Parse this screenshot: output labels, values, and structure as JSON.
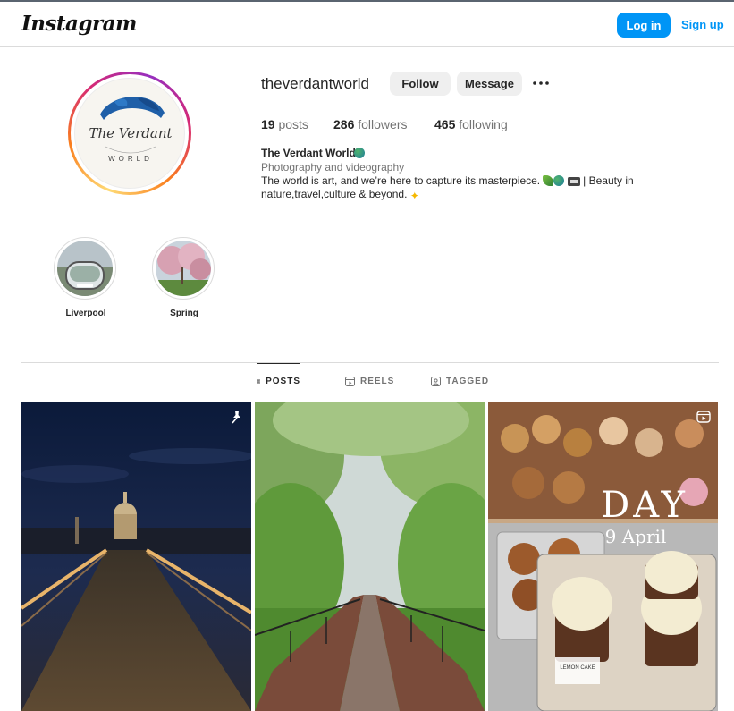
{
  "header": {
    "logo": "Instagram",
    "login_label": "Log in",
    "signup_label": "Sign up"
  },
  "profile": {
    "username": "theverdantworld",
    "follow_label": "Follow",
    "message_label": "Message",
    "stats": {
      "posts_count": "19",
      "posts_label": "posts",
      "followers_count": "286",
      "followers_label": "followers",
      "following_count": "465",
      "following_label": "following"
    },
    "full_name": "The Verdant World",
    "category": "Photography and videography",
    "bio_line1": "The world is art, and we’re here to capture its masterpiece.",
    "bio_line1_tail": "| Beauty in",
    "bio_line2": "nature,travel,culture & beyond.",
    "avatar_text_main": "The Verdant",
    "avatar_text_sub": "WORLD"
  },
  "highlights": [
    {
      "label": "Liverpool"
    },
    {
      "label": "Spring"
    }
  ],
  "tabs": [
    {
      "label": "POSTS",
      "icon": "grid-icon",
      "active": true
    },
    {
      "label": "REELS",
      "icon": "reels-icon",
      "active": false
    },
    {
      "label": "TAGGED",
      "icon": "tagged-icon",
      "active": false
    }
  ],
  "posts": [
    {
      "subject": "Night bridge with illuminated dome",
      "badge": "pin-icon"
    },
    {
      "subject": "Tree-lined brick path in park",
      "badge": ""
    },
    {
      "subject": "Bakery display of pastries",
      "badge": "reel-icon",
      "overlay_title": "DAY",
      "overlay_date": "9 April",
      "price_label": "LEMON CAKE"
    }
  ],
  "colors": {
    "accent": "#0095f6",
    "text": "#262626",
    "muted": "#737373",
    "border": "#dbdbdb",
    "button_bg": "#efefef"
  }
}
